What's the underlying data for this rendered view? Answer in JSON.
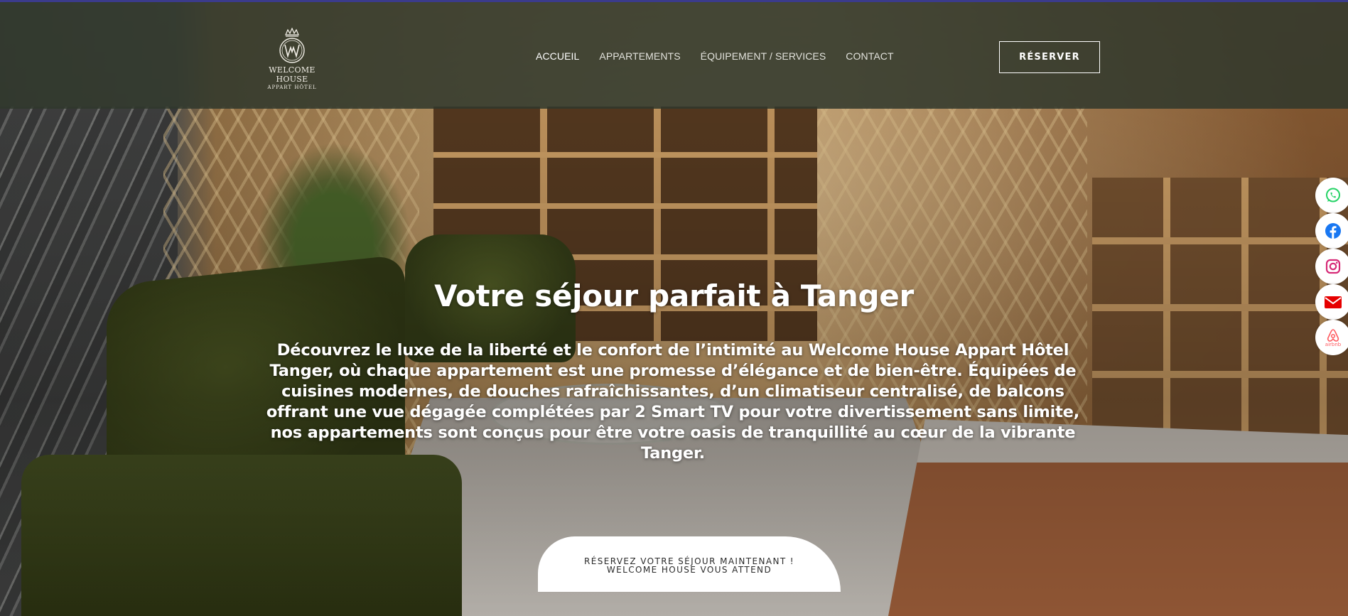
{
  "logo": {
    "name": "WELCOME HOUSE",
    "subtitle": "APPART HÔTEL",
    "icon": "crown-monogram-icon"
  },
  "nav": {
    "items": [
      {
        "label": "ACCUEIL",
        "active": true
      },
      {
        "label": "APPARTEMENTS",
        "active": false
      },
      {
        "label": "ÉQUIPEMENT / SERVICES",
        "active": false
      },
      {
        "label": "CONTACT",
        "active": false
      }
    ],
    "reserve_label": "RÉSERVER"
  },
  "hero": {
    "title": "Votre séjour parfait à Tanger",
    "description": "Découvrez le luxe de la liberté et le confort de l’intimité au Welcome House Appart Hôtel Tanger, où chaque appartement est une promesse d’élégance et de bien-être. Équipées de cuisines modernes, de douches rafraîchissantes, d’un climatiseur centralisé, de balcons offrant une vue dégagée complétées par 2 Smart TV pour votre divertissement sans limite, nos appartements sont conçus pour être votre oasis de tranquillité au cœur de la vibrante Tanger.",
    "cta_line1": "RÉSERVEZ VOTRE SÉJOUR MAINTENANT !",
    "cta_line2": "WELCOME HOUSE VOUS ATTEND"
  },
  "social": [
    {
      "name": "whatsapp-icon",
      "color": "#25D366"
    },
    {
      "name": "facebook-icon",
      "color": "#1877F2"
    },
    {
      "name": "instagram-icon",
      "color": "#D62976"
    },
    {
      "name": "email-icon",
      "color": "#E60000"
    },
    {
      "name": "airbnb-icon",
      "color": "#FF5A5F",
      "label": "airbnb"
    }
  ],
  "colors": {
    "header_bg": "#30382C",
    "accent_line": "#3B3B8C"
  }
}
